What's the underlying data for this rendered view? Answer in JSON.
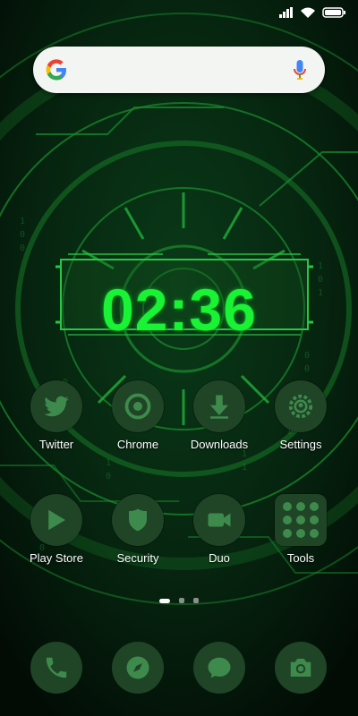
{
  "clock": {
    "time": "02:36"
  },
  "apps_row1": [
    {
      "label": "Twitter",
      "icon": "twitter-icon"
    },
    {
      "label": "Chrome",
      "icon": "chrome-icon"
    },
    {
      "label": "Downloads",
      "icon": "download-icon"
    },
    {
      "label": "Settings",
      "icon": "gear-icon"
    }
  ],
  "apps_row2": [
    {
      "label": "Play Store",
      "icon": "play-store-icon"
    },
    {
      "label": "Security",
      "icon": "shield-icon"
    },
    {
      "label": "Duo",
      "icon": "video-camera-icon"
    },
    {
      "label": "Tools",
      "icon": "folder-icon"
    }
  ],
  "dock": [
    {
      "icon": "phone-icon"
    },
    {
      "icon": "compass-icon"
    },
    {
      "icon": "message-icon"
    },
    {
      "icon": "camera-icon"
    }
  ],
  "page_indicator": {
    "pages": 3,
    "current": 1
  },
  "colors": {
    "icon_bg": "#1f4426",
    "icon_glyph": "#3e8a4c",
    "clock": "#19f235",
    "wallpaper_base": "#03140a",
    "wallpaper_line": "#1a8a2c"
  }
}
